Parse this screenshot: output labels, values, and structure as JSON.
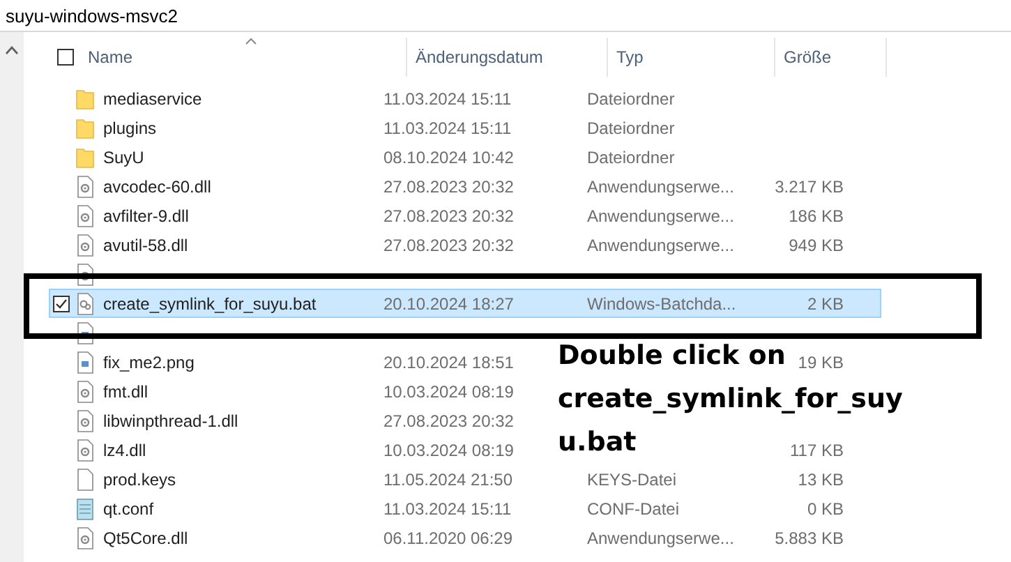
{
  "address_bar": {
    "path": "suyu-windows-msvc2"
  },
  "table": {
    "select_all": {
      "checked": false
    },
    "columns": [
      {
        "label": "Name",
        "sorted": true
      },
      {
        "label": "Änderungsdatum",
        "sorted": false
      },
      {
        "label": "Typ",
        "sorted": false
      },
      {
        "label": "Größe",
        "sorted": false
      }
    ],
    "rows": [
      {
        "kind": "folder",
        "name": "mediaservice",
        "date": "11.03.2024 15:11",
        "type": "Dateiordner",
        "selected": false
      },
      {
        "kind": "folder",
        "name": "plugins",
        "date": "11.03.2024 15:11",
        "type": "Dateiordner",
        "selected": false
      },
      {
        "kind": "folder",
        "name": "SuyU",
        "date": "08.10.2024 10:42",
        "type": "Dateiordner",
        "selected": false
      },
      {
        "kind": "dll",
        "name": "avcodec-60.dll",
        "date": "27.08.2023 20:32",
        "type": "Anwendungserwe...",
        "size": "3.217 KB",
        "selected": false
      },
      {
        "kind": "dll",
        "name": "avfilter-9.dll",
        "date": "27.08.2023 20:32",
        "type": "Anwendungserwe...",
        "size": "186 KB",
        "selected": false
      },
      {
        "kind": "dll",
        "name": "avutil-58.dll",
        "date": "27.08.2023 20:32",
        "type": "Anwendungserwe...",
        "size": "949 KB",
        "selected": false
      },
      {
        "kind": "dll",
        "selected": false
      },
      {
        "kind": "bat",
        "name": "create_symlink_for_suyu.bat",
        "date": "20.10.2024 18:27",
        "type": "Windows-Batchda...",
        "size": "2 KB",
        "selected": true
      },
      {
        "kind": "image",
        "selected": false
      },
      {
        "kind": "image",
        "name": "fix_me2.png",
        "date": "20.10.2024 18:51",
        "size": "19 KB",
        "selected": false
      },
      {
        "kind": "dll",
        "name": "fmt.dll",
        "date": "10.03.2024 08:19",
        "selected": false
      },
      {
        "kind": "dll",
        "name": "libwinpthread-1.dll",
        "date": "27.08.2023 20:32",
        "selected": false
      },
      {
        "kind": "dll",
        "name": "lz4.dll",
        "date": "10.03.2024 08:19",
        "size": "117 KB",
        "selected": false
      },
      {
        "kind": "blank",
        "name": "prod.keys",
        "date": "11.05.2024 21:50",
        "type": "KEYS-Datei",
        "size": "13 KB",
        "selected": false
      },
      {
        "kind": "text",
        "name": "qt.conf",
        "date": "11.03.2024 15:11",
        "type": "CONF-Datei",
        "size": "0 KB",
        "selected": false
      },
      {
        "kind": "dll",
        "name": "Qt5Core.dll",
        "date": "06.11.2020 06:29",
        "type": "Anwendungserwe...",
        "size": "5.883 KB",
        "selected": false
      }
    ]
  },
  "annotation": {
    "lines": [
      "Double click on",
      "create_symlink_for_suy",
      "u.bat"
    ]
  }
}
